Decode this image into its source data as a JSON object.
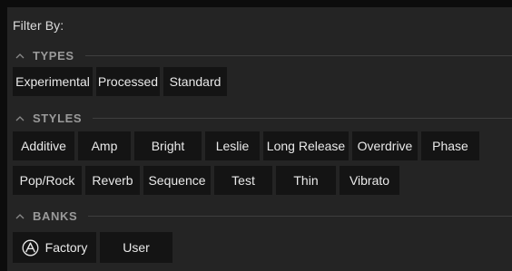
{
  "filter_title": "Filter By:",
  "sections": {
    "types": {
      "label": "TYPES",
      "icon": "chevron-up-icon",
      "tags": [
        "Experimental",
        "Processed",
        "Standard"
      ]
    },
    "styles": {
      "label": "STYLES",
      "icon": "chevron-up-icon",
      "tags": [
        "Additive",
        "Amp",
        "Bright",
        "Leslie",
        "Long Release",
        "Overdrive",
        "Phase",
        "Pop/Rock",
        "Reverb",
        "Sequence",
        "Test",
        "Thin",
        "Vibrato"
      ]
    },
    "banks": {
      "label": "BANKS",
      "icon": "chevron-up-icon",
      "tags": [
        {
          "label": "Factory",
          "icon": "arturia-logo-icon"
        },
        {
          "label": "User"
        }
      ]
    }
  },
  "colors": {
    "background": "#242424",
    "tag_background": "#141414",
    "section_label": "#9a9a9a",
    "text": "#e9e9e9"
  }
}
